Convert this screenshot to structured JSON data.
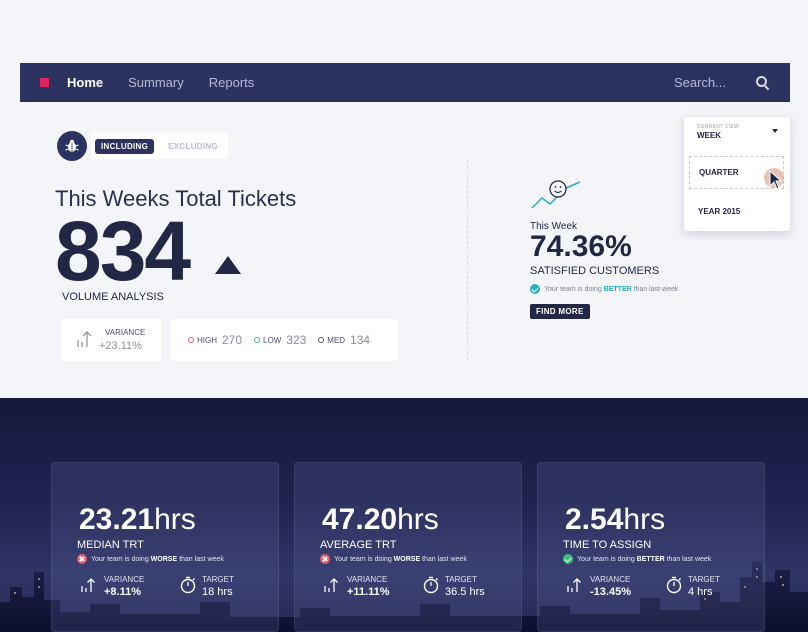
{
  "nav": {
    "items": [
      {
        "label": "Home",
        "active": true
      },
      {
        "label": "Summary",
        "active": false
      },
      {
        "label": "Reports",
        "active": false
      }
    ],
    "search_placeholder": "Search..."
  },
  "toggle": {
    "including": "INCLUDING",
    "excluding": "EXCLUDING"
  },
  "tickets": {
    "title": "This Weeks Total Tickets",
    "count": "834",
    "subtitle": "VOLUME ANALYSIS",
    "variance_label": "VARIANCE",
    "variance_value": "+23.11%",
    "priorities": [
      {
        "label": "HIGH",
        "value": "270",
        "color": "#e35d6a"
      },
      {
        "label": "LOW",
        "value": "323",
        "color": "#3bc27a"
      },
      {
        "label": "MED",
        "value": "134",
        "color": "#4a4f6d"
      }
    ]
  },
  "satisfaction": {
    "period": "This Week",
    "percent": "74.36%",
    "label": "SATISFIED CUSTOMERS",
    "status_prefix": "Your team is doing ",
    "status_word": "BETTER",
    "status_suffix": " than last week",
    "cta": "FIND MORE"
  },
  "view_dropdown": {
    "current_label": "CURRENT VIEW",
    "current_value": "WEEK",
    "options": [
      "QUARTER",
      "YEAR 2015"
    ]
  },
  "metrics": [
    {
      "value": "23.21",
      "unit": "hrs",
      "title": "MEDIAN TRT",
      "status_prefix": "Your team is doing ",
      "status_word": "WORSE",
      "status_suffix": " than last week",
      "variance_label": "VARIANCE",
      "variance": "+8.11%",
      "target_label": "TARGET",
      "target": "18 hrs"
    },
    {
      "value": "47.20",
      "unit": "hrs",
      "title": "AVERAGE TRT",
      "status_prefix": "Your team is doing ",
      "status_word": "WORSE",
      "status_suffix": " than last week",
      "variance_label": "VARIANCE",
      "variance": "+11.11%",
      "target_label": "TARGET",
      "target": "36.5 hrs"
    },
    {
      "value": "2.54",
      "unit": "hrs",
      "title": "TIME TO ASSIGN",
      "status_prefix": "Your team is doing ",
      "status_word": "BETTER",
      "status_suffix": " than last week",
      "variance_label": "VARIANCE",
      "variance": "-13.45%",
      "target_label": "TARGET",
      "target": "4 hrs"
    }
  ],
  "colors": {
    "navy": "#2d3361",
    "dark": "#222746",
    "accent_pink": "#e0245e",
    "teal": "#2ab0c5",
    "bad": "#e35d6a",
    "good": "#3bc27a"
  }
}
